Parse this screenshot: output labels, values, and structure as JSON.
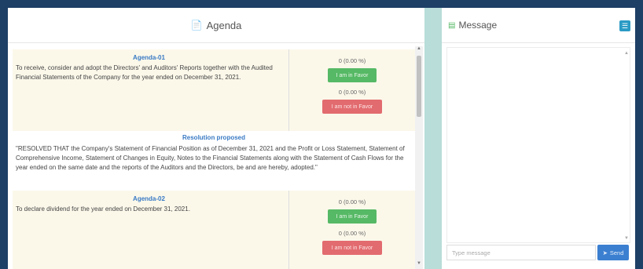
{
  "agenda_panel": {
    "title": "Agenda",
    "icon": "document-icon",
    "items": [
      {
        "title": "Agenda-01",
        "text": "To receive, consider and adopt the Directors' and Auditors' Reports together with the Audited Financial Statements of the Company for the year ended on December 31, 2021.",
        "favor_count": "0 (0.00 %)",
        "favor_label": "I am in Favor",
        "not_favor_count": "0 (0.00 %)",
        "not_favor_label": "I am not in Favor"
      },
      {
        "title": "Agenda-02",
        "text": "To declare dividend for the year ended on December 31, 2021.",
        "favor_count": "0 (0.00 %)",
        "favor_label": "I am in Favor",
        "not_favor_count": "0 (0.00 %)",
        "not_favor_label": "I am not in Favor"
      }
    ],
    "resolution": {
      "title": "Resolution proposed",
      "text": "\"RESOLVED THAT the Company's Statement of Financial Position as of December 31, 2021 and the Profit or Loss Statement, Statement of Comprehensive Income, Statement of Changes in Equity, Notes to the Financial Statements along with the Statement of Cash Flows for the year ended on the same date and the reports of the Auditors and the Directors, be and are hereby, adopted.\""
    }
  },
  "message_panel": {
    "title": "Message",
    "icon": "chat-icon",
    "input_placeholder": "Type message",
    "send_label": "Send"
  },
  "colors": {
    "background": "#1e3f66",
    "favor": "#56b965",
    "not_favor": "#e26b6f",
    "send": "#3b7fd1",
    "agenda_title": "#3a7ac4"
  }
}
